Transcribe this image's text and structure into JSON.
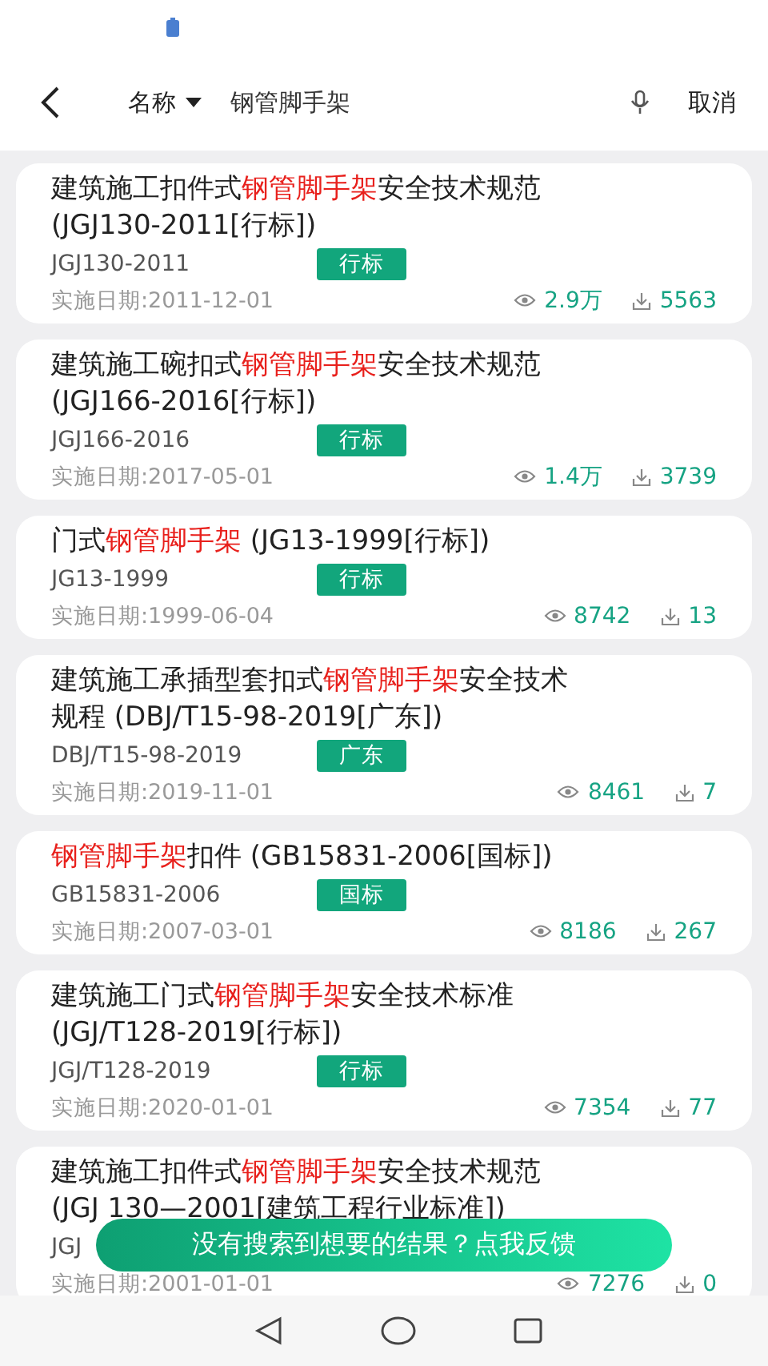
{
  "header": {
    "filter": "名称",
    "query": "钢管脚手架",
    "cancel": "取消"
  },
  "results": [
    {
      "title": [
        {
          "text": "建筑施工扣件式",
          "highlight": false
        },
        {
          "text": "钢管脚手架",
          "highlight": true
        },
        {
          "text": "安全技术规范(JGJ130-2011[行标])",
          "highlight": false
        }
      ],
      "code": "JGJ130-2011",
      "tag": "行标",
      "date": "实施日期:2011-12-01",
      "views": "2.9万",
      "downloads": "5563"
    },
    {
      "title": [
        {
          "text": "建筑施工碗扣式",
          "highlight": false
        },
        {
          "text": "钢管脚手架",
          "highlight": true
        },
        {
          "text": "安全技术规范(JGJ166-2016[行标])",
          "highlight": false
        }
      ],
      "code": "JGJ166-2016",
      "tag": "行标",
      "date": "实施日期:2017-05-01",
      "views": "1.4万",
      "downloads": "3739"
    },
    {
      "title": [
        {
          "text": "门式",
          "highlight": false
        },
        {
          "text": "钢管脚手架",
          "highlight": true
        },
        {
          "text": " (JG13-1999[行标])",
          "highlight": false
        }
      ],
      "code": "JG13-1999",
      "tag": "行标",
      "date": "实施日期:1999-06-04",
      "views": "8742",
      "downloads": "13"
    },
    {
      "title": [
        {
          "text": "建筑施工承插型套扣式",
          "highlight": false
        },
        {
          "text": "钢管脚手架",
          "highlight": true
        },
        {
          "text": "安全技术规程 (DBJ/T15-98-2019[广东])",
          "highlight": false
        }
      ],
      "code": "DBJ/T15-98-2019",
      "tag": "广东",
      "date": "实施日期:2019-11-01",
      "views": "8461",
      "downloads": "7"
    },
    {
      "title": [
        {
          "text": "钢管脚手架",
          "highlight": true
        },
        {
          "text": "扣件 (GB15831-2006[国标])",
          "highlight": false
        }
      ],
      "code": "GB15831-2006",
      "tag": "国标",
      "date": "实施日期:2007-03-01",
      "views": "8186",
      "downloads": "267"
    },
    {
      "title": [
        {
          "text": "建筑施工门式",
          "highlight": false
        },
        {
          "text": "钢管脚手架",
          "highlight": true
        },
        {
          "text": "安全技术标准(JGJ/T128-2019[行标])",
          "highlight": false
        }
      ],
      "code": "JGJ/T128-2019",
      "tag": "行标",
      "date": "实施日期:2020-01-01",
      "views": "7354",
      "downloads": "77"
    },
    {
      "title": [
        {
          "text": "建筑施工扣件式",
          "highlight": false
        },
        {
          "text": "钢管脚手架",
          "highlight": true
        },
        {
          "text": "安全技术规范(JGJ 130—2001[建筑工程行业标准])",
          "highlight": false
        }
      ],
      "code": "JGJ",
      "date": "实施日期:2001-01-01",
      "views": "7276",
      "downloads": "0"
    }
  ],
  "feedback": "没有搜索到想要的结果？点我反馈"
}
